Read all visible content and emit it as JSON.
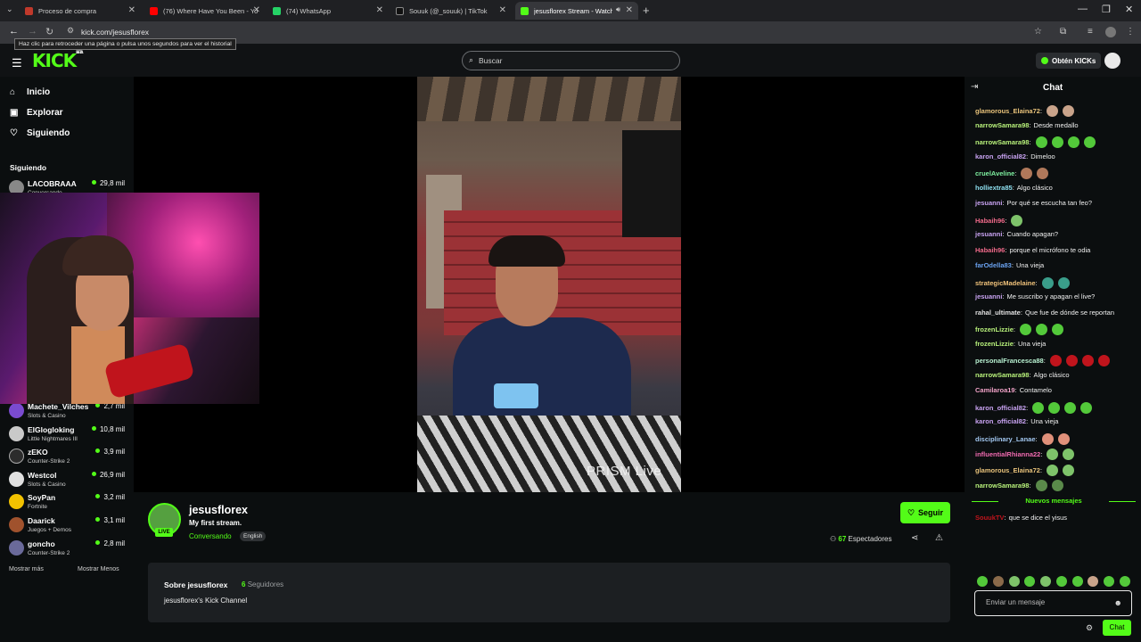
{
  "browser": {
    "tabs": [
      {
        "label": "Proceso de compra",
        "color": "#c0392b"
      },
      {
        "label": "(76) Where Have You Been - Yo",
        "color": "#ff0000"
      },
      {
        "label": "(74) WhatsApp",
        "color": "#25d366"
      },
      {
        "label": "Souuk (@_souuk) | TikTok",
        "color": "#111111"
      },
      {
        "label": "jesusflorex Stream - Watch",
        "color": "#53fc18"
      }
    ],
    "new_tab": "+",
    "url": "kick.com/jesusflorex",
    "tooltip": "Haz clic para retroceder una página o pulsa unos segundos para ver el historial"
  },
  "header": {
    "logo": "KICK",
    "logo_sup": "BETA",
    "search_placeholder": "Buscar",
    "obten": "Obtén KICKs"
  },
  "sidebar": {
    "nav": [
      {
        "label": "Inicio",
        "icon": "home-icon"
      },
      {
        "label": "Explorar",
        "icon": "compass-icon"
      },
      {
        "label": "Siguiendo",
        "icon": "heart-icon"
      }
    ],
    "following_title": "Siguiendo",
    "channels": [
      {
        "name": "LACOBRAAA",
        "category": "Conversando",
        "viewers": "29,8 mil",
        "color": "#888888"
      },
      {
        "name": "Machete_Vilches",
        "category": "Slots & Casino",
        "viewers": "2,7 mil",
        "color": "#7a4bd0"
      },
      {
        "name": "ElGlogloking",
        "category": "Little Nightmares III",
        "viewers": "10,8 mil",
        "color": "#c9c9c9"
      },
      {
        "name": "zEKO",
        "category": "Counter-Strike 2",
        "viewers": "3,9 mil",
        "color": "#2c2c2c"
      },
      {
        "name": "Westcol",
        "category": "Slots & Casino",
        "viewers": "26,9 mil",
        "color": "#e0e0e0"
      },
      {
        "name": "SoyPan",
        "category": "Fortnite",
        "viewers": "3,2 mil",
        "color": "#f2c200"
      },
      {
        "name": "Daarick",
        "category": "Juegos + Demos",
        "viewers": "3,1 mil",
        "color": "#a0522d"
      },
      {
        "name": "goncho",
        "category": "Counter-Strike 2",
        "viewers": "2,8 mil",
        "color": "#6a6a9a"
      }
    ],
    "show_more": "Mostrar más",
    "show_less": "Mostrar Menos"
  },
  "video": {
    "watermark": "PRISM Live"
  },
  "streamer": {
    "name": "jesusflorex",
    "title": "My first stream.",
    "category": "Conversando",
    "language": "English",
    "live_badge": "LIVE",
    "follow": "Seguir",
    "viewers_count": "67",
    "viewers_label": "Espectadores"
  },
  "about": {
    "title": "Sobre jesusflorex",
    "followers_count": "6",
    "followers_label": "Seguidores",
    "description": "jesusflorex's Kick Channel"
  },
  "chat": {
    "title": "Chat",
    "new_messages": "Nuevos mensajes",
    "input_placeholder": "Enviar un mensaje",
    "send": "Chat",
    "messages": [
      {
        "user": "glamorous_Elaina72",
        "color": "#e8c27a",
        "text": "",
        "emotes": [
          "#c9a38a",
          "#c9a38a"
        ]
      },
      {
        "user": "narrowSamara98",
        "color": "#b7f07a",
        "text": "Desde medallo",
        "emotes": []
      },
      {
        "user": "narrowSamara98",
        "color": "#b7f07a",
        "text": "",
        "emotes": [
          "#53c93a",
          "#53c93a",
          "#53c93a",
          "#53c93a"
        ]
      },
      {
        "user": "karon_official82",
        "color": "#c7a2f0",
        "text": "Dimeloo",
        "emotes": []
      },
      {
        "user": "cruelAveline",
        "color": "#7ef0a0",
        "text": "",
        "emotes": [
          "#b0785a",
          "#b0785a"
        ]
      },
      {
        "user": "holliextra85",
        "color": "#8ee0f0",
        "text": "Algo clásico",
        "emotes": []
      },
      {
        "user": "jesuanni",
        "color": "#c7a2f0",
        "text": "Por qué se escucha tan feo?",
        "emotes": []
      },
      {
        "user": "Habaih96",
        "color": "#f06a8a",
        "text": "",
        "emotes": [
          "#7ec36a"
        ]
      },
      {
        "user": "jesuanni",
        "color": "#c7a2f0",
        "text": "Cuando apagan?",
        "emotes": []
      },
      {
        "user": "Habaih96",
        "color": "#f06a8a",
        "text": "porque el micrófono te odia",
        "emotes": []
      },
      {
        "user": "farOdella83",
        "color": "#6aa2f0",
        "text": "Una vieja",
        "emotes": []
      },
      {
        "user": "strategicMadelaine",
        "color": "#f0c27a",
        "text": "",
        "emotes": [
          "#3a9e8a",
          "#3a9e8a"
        ]
      },
      {
        "user": "jesuanni",
        "color": "#c7a2f0",
        "text": "Me suscribo y apagan el live?",
        "emotes": []
      },
      {
        "user": "rahal_ultimate",
        "color": "#e0e0e0",
        "text": "Que fue de dónde se reportan",
        "emotes": []
      },
      {
        "user": "frozenLizzie",
        "color": "#b7f07a",
        "text": "",
        "emotes": [
          "#53c93a",
          "#53c93a",
          "#53c93a"
        ]
      },
      {
        "user": "frozenLizzie",
        "color": "#b7f07a",
        "text": "Una vieja",
        "emotes": []
      },
      {
        "user": "personalFrancesca88",
        "color": "#b7f0d0",
        "text": "",
        "emotes": [
          "#c0141c",
          "#c0141c",
          "#c0141c",
          "#c0141c"
        ]
      },
      {
        "user": "narrowSamara98",
        "color": "#b7f07a",
        "text": "Algo clásico",
        "emotes": []
      },
      {
        "user": "Camilaroa19",
        "color": "#f0a2c7",
        "text": "Contamelo",
        "emotes": []
      },
      {
        "user": "karon_official82",
        "color": "#c7a2f0",
        "text": "",
        "emotes": [
          "#53c93a",
          "#53c93a",
          "#53c93a",
          "#53c93a"
        ]
      },
      {
        "user": "karon_official82",
        "color": "#c7a2f0",
        "text": "Una vieja",
        "emotes": []
      },
      {
        "user": "disciplinary_Lanae",
        "color": "#a2c7f0",
        "text": "",
        "emotes": [
          "#e0907a",
          "#e0907a"
        ]
      },
      {
        "user": "influentialRhianna22",
        "color": "#f06ab0",
        "text": "",
        "emotes": [
          "#7ec36a",
          "#7ec36a"
        ]
      },
      {
        "user": "glamorous_Elaina72",
        "color": "#e8c27a",
        "text": "",
        "emotes": [
          "#7ec36a",
          "#7ec36a"
        ]
      },
      {
        "user": "narrowSamara98",
        "color": "#b7f07a",
        "text": "",
        "emotes": [
          "#5a8a4a",
          "#5a8a4a"
        ]
      }
    ],
    "new_message": {
      "user": "SouukTV",
      "color": "#c0141c",
      "text": "que se dice el yisus"
    }
  }
}
